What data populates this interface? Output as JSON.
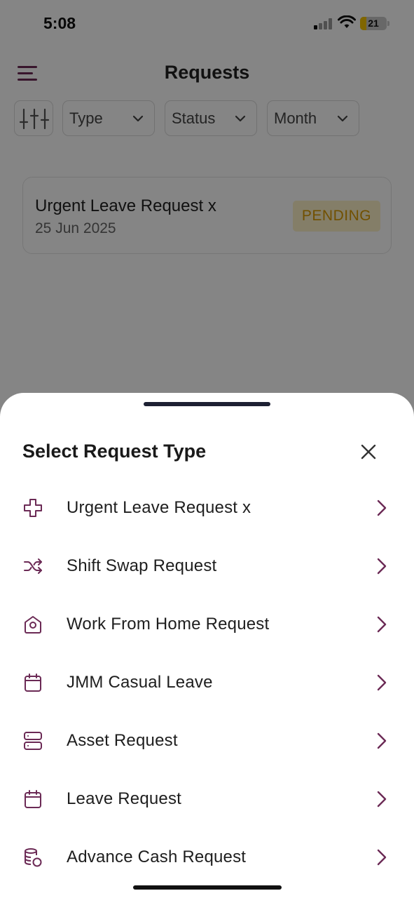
{
  "status_bar": {
    "time": "5:08",
    "battery": "21"
  },
  "header": {
    "title": "Requests"
  },
  "filters": [
    {
      "label": "Type"
    },
    {
      "label": "Status"
    },
    {
      "label": "Month"
    }
  ],
  "request_card": {
    "title": "Urgent Leave Request x",
    "date": "25 Jun 2025",
    "status": "PENDING"
  },
  "sheet": {
    "title": "Select Request Type",
    "options": [
      {
        "label": "Urgent Leave Request x",
        "icon": "medical-cross-icon"
      },
      {
        "label": "Shift Swap Request",
        "icon": "shuffle-icon"
      },
      {
        "label": "Work From Home Request",
        "icon": "home-icon"
      },
      {
        "label": "JMM Casual Leave",
        "icon": "calendar-icon"
      },
      {
        "label": "Asset Request",
        "icon": "server-icon"
      },
      {
        "label": "Leave Request",
        "icon": "calendar-icon"
      },
      {
        "label": "Advance Cash Request",
        "icon": "coins-icon"
      }
    ]
  },
  "colors": {
    "accent": "#6b2a55",
    "pending_bg": "#fdf1c8",
    "pending_text": "#d99a00"
  }
}
